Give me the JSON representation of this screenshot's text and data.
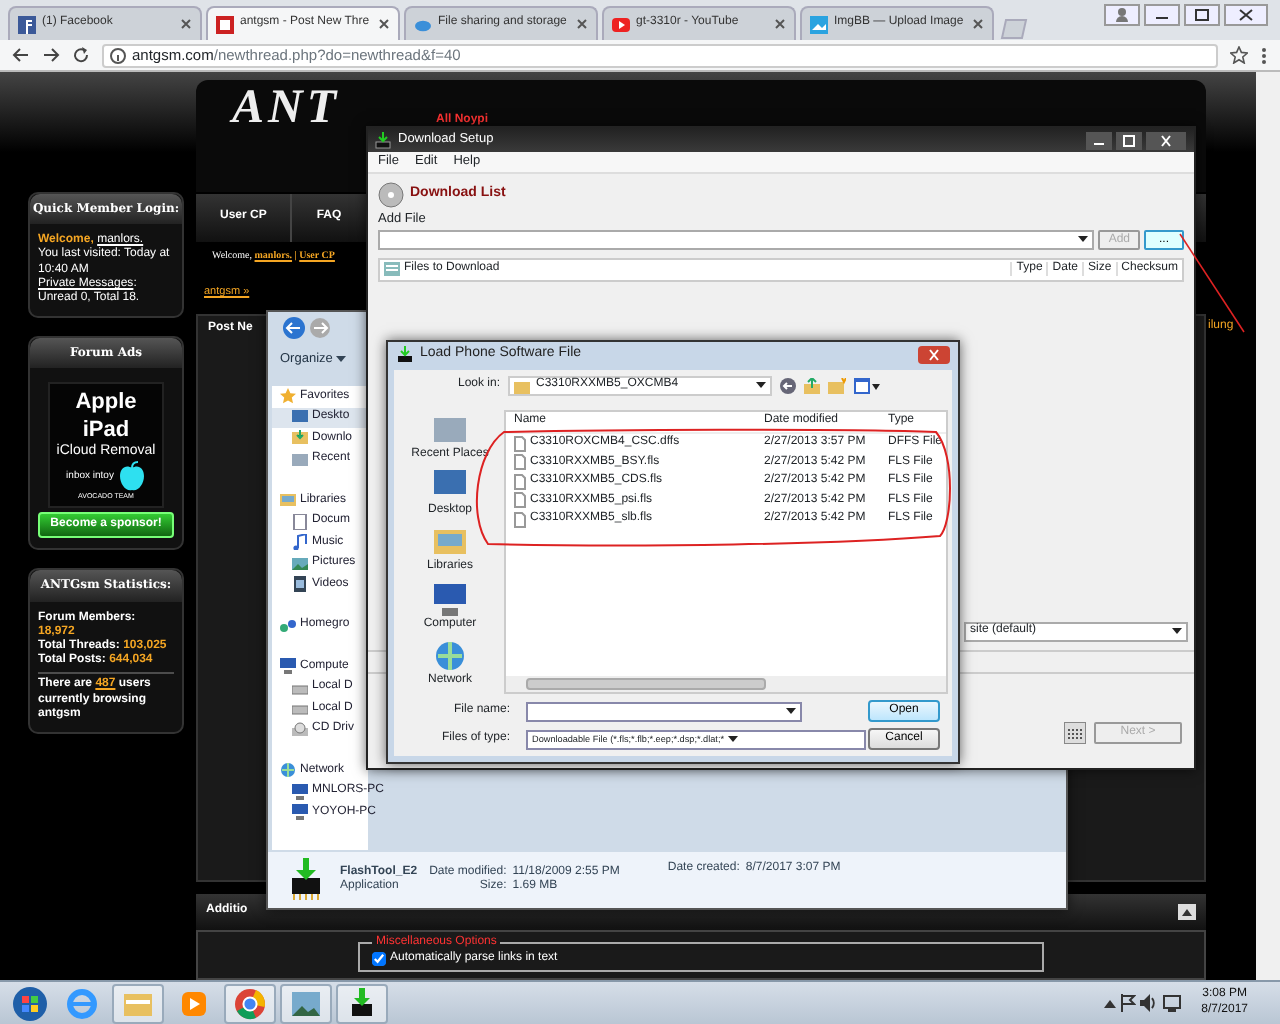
{
  "browser": {
    "tabs": [
      {
        "title": "(1) Facebook",
        "kind": "facebook",
        "selected": false
      },
      {
        "title": "antgsm - Post New Thre",
        "kind": "antgsm",
        "selected": true
      },
      {
        "title": "File sharing and storage",
        "kind": "cloud",
        "selected": false
      },
      {
        "title": "gt-3310r - YouTube",
        "kind": "video",
        "selected": false
      },
      {
        "title": "ImgBB — Upload Image",
        "kind": "imgbb",
        "selected": false
      }
    ],
    "address": {
      "host": "antgsm.com",
      "path": "/newthread.php?do=newthread&f=40"
    }
  },
  "forum": {
    "logo": "ANT",
    "tagline": "All Noypi",
    "login_box": {
      "title": "Quick Member Login:",
      "welcome": "Welcome,",
      "user": "manlors.",
      "visited": "You last visited: Today at 10:40 AM",
      "pm_link": "Private Messages",
      "pm_text": ": Unread 0, Total 18."
    },
    "ads_box": {
      "title": "Forum Ads",
      "ad_lines": [
        "Apple iPad",
        "iCloud Removal",
        "inbox intoy",
        "AVOCADO TEAM"
      ],
      "sponsor_button": "Become a sponsor!"
    },
    "stats_box": {
      "title": "ANTGsm Statistics:",
      "stats": [
        {
          "label": "Forum Members:",
          "value": "18,972"
        },
        {
          "label": "Total Threads:",
          "value": "103,025"
        },
        {
          "label": "Total Posts:",
          "value": "644,034"
        }
      ],
      "online_pre": "There are",
      "online_count": "487",
      "online_post": "users currently browsing antgsm"
    },
    "nav": [
      "User CP",
      "FAQ"
    ],
    "welcome_bar": {
      "text": "Welcome,",
      "user": "manlors.",
      "sep": "|",
      "link": "User CP"
    },
    "breadcrumb": "antgsm »",
    "post_title": "Post Ne",
    "side_text": "ilung",
    "additional_title": "Additio",
    "misc_legend": "Miscellaneous Options",
    "options": [
      {
        "label": "Automatically parse links in text",
        "checked": true
      }
    ]
  },
  "explorer": {
    "organize": "Organize",
    "tree": [
      {
        "label": "Favorites",
        "kind": "star",
        "selected": false,
        "children": [
          {
            "label": "Deskto",
            "kind": "desktop",
            "selected": true
          },
          {
            "label": "Downlo",
            "kind": "download",
            "selected": false
          },
          {
            "label": "Recent",
            "kind": "recent",
            "selected": false
          }
        ]
      },
      {
        "label": "Libraries",
        "kind": "library",
        "selected": false,
        "children": [
          {
            "label": "Docum",
            "kind": "document",
            "selected": false
          },
          {
            "label": "Music",
            "kind": "music",
            "selected": false
          },
          {
            "label": "Pictures",
            "kind": "picture",
            "selected": false
          },
          {
            "label": "Videos",
            "kind": "video",
            "selected": false
          }
        ]
      },
      {
        "label": "Homegro",
        "kind": "homegroup",
        "selected": false
      },
      {
        "label": "Compute",
        "kind": "computer",
        "selected": false,
        "children": [
          {
            "label": "Local D",
            "kind": "drive",
            "selected": false
          },
          {
            "label": "Local D",
            "kind": "drive",
            "selected": false
          },
          {
            "label": "CD Driv",
            "kind": "cd",
            "selected": false
          }
        ]
      },
      {
        "label": "Network",
        "kind": "network",
        "selected": false,
        "children": [
          {
            "label": "MNLORS-PC",
            "kind": "computer",
            "selected": false
          },
          {
            "label": "YOYOH-PC",
            "kind": "computer",
            "selected": false
          }
        ]
      }
    ],
    "details": {
      "name": "FlashTool_E2",
      "type": "Application",
      "fields": [
        {
          "label": "Date modified:",
          "value": "11/18/2009 2:55 PM"
        },
        {
          "label": "Size:",
          "value": "1.69 MB"
        },
        {
          "label": "Date created:",
          "value": "8/7/2017 3:07 PM"
        }
      ]
    }
  },
  "download_setup": {
    "title": "Download Setup",
    "menu": [
      "File",
      "Edit",
      "Help"
    ],
    "section": "Download List",
    "add_label": "Add File",
    "add_button": {
      "label": "Add",
      "disabled": true
    },
    "browse_button": "...",
    "columns": [
      "Files to Download",
      "Type",
      "Date",
      "Size",
      "Checksum"
    ],
    "mode_value": "site (default)",
    "next_button": {
      "label": "Next >",
      "disabled": true
    }
  },
  "load_dialog": {
    "title": "Load Phone Software File",
    "look_in_label": "Look in:",
    "folder": "C3310RXXMB5_OXCMB4",
    "places": [
      {
        "label": "Recent Places",
        "kind": "recent"
      },
      {
        "label": "Desktop",
        "kind": "desktop"
      },
      {
        "label": "Libraries",
        "kind": "library"
      },
      {
        "label": "Computer",
        "kind": "computer"
      },
      {
        "label": "Network",
        "kind": "network"
      }
    ],
    "columns": [
      "Name",
      "Date modified",
      "Type"
    ],
    "files": [
      {
        "name": "C3310ROXCMB4_CSC.dffs",
        "date": "2/27/2013 3:57 PM",
        "type": "DFFS File"
      },
      {
        "name": "C3310RXXMB5_BSY.fls",
        "date": "2/27/2013 5:42 PM",
        "type": "FLS File"
      },
      {
        "name": "C3310RXXMB5_CDS.fls",
        "date": "2/27/2013 5:42 PM",
        "type": "FLS File"
      },
      {
        "name": "C3310RXXMB5_psi.fls",
        "date": "2/27/2013 5:42 PM",
        "type": "FLS File"
      },
      {
        "name": "C3310RXXMB5_slb.fls",
        "date": "2/27/2013 5:42 PM",
        "type": "FLS File"
      }
    ],
    "file_name_label": "File name:",
    "file_type_label": "Files of type:",
    "file_type_value": "Downloadable File (*.fls;*.flb;*.eep;*.dsp;*.dlat;*",
    "open_button": "Open",
    "cancel_button": "Cancel"
  },
  "taskbar": {
    "time": "3:08 PM",
    "date": "8/7/2017"
  }
}
